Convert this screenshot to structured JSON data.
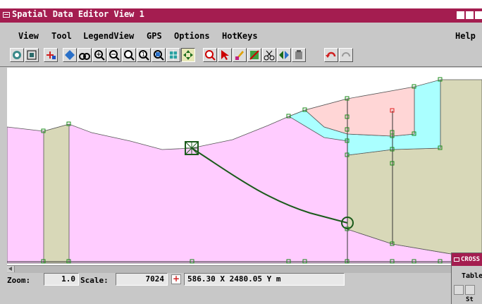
{
  "window": {
    "title": "Spatial Data Editor View 1"
  },
  "menu": {
    "items": [
      "View",
      "Tool",
      "LegendView",
      "GPS",
      "Options",
      "HotKeys"
    ],
    "help": "Help"
  },
  "toolbar": {
    "tools": [
      "view-icon",
      "extent-icon",
      "add-layer-icon",
      "select-mode-icon",
      "binoculars-icon",
      "zoom-in-icon",
      "zoom-out-icon",
      "zoom-area-icon",
      "zoom-full-icon",
      "zoom-box-icon",
      "pan-icon",
      "select-tool-icon",
      "find-icon",
      "pointer-icon",
      "edit-element-icon",
      "select-region-icon",
      "cut-icon",
      "copy-layer-icon",
      "paste-icon",
      "undo-icon",
      "redo-icon"
    ]
  },
  "status": {
    "zoom_label": "Zoom:",
    "zoom_value": "1.0",
    "scale_label": "Scale:",
    "scale_value": "7024",
    "coordinates": "586.30 X  2480.05 Y m"
  },
  "cross_section_panel": {
    "title": "CROSS",
    "menu": "Table",
    "subtitle": "St"
  },
  "colors": {
    "titlebar": "#a41d50",
    "pink_unit": "#ffccff",
    "tan_unit": "#d8d8b8",
    "cyan_unit": "#aaffff",
    "salmon_unit": "#ffd6d6",
    "line_green": "#1a5a1a"
  }
}
